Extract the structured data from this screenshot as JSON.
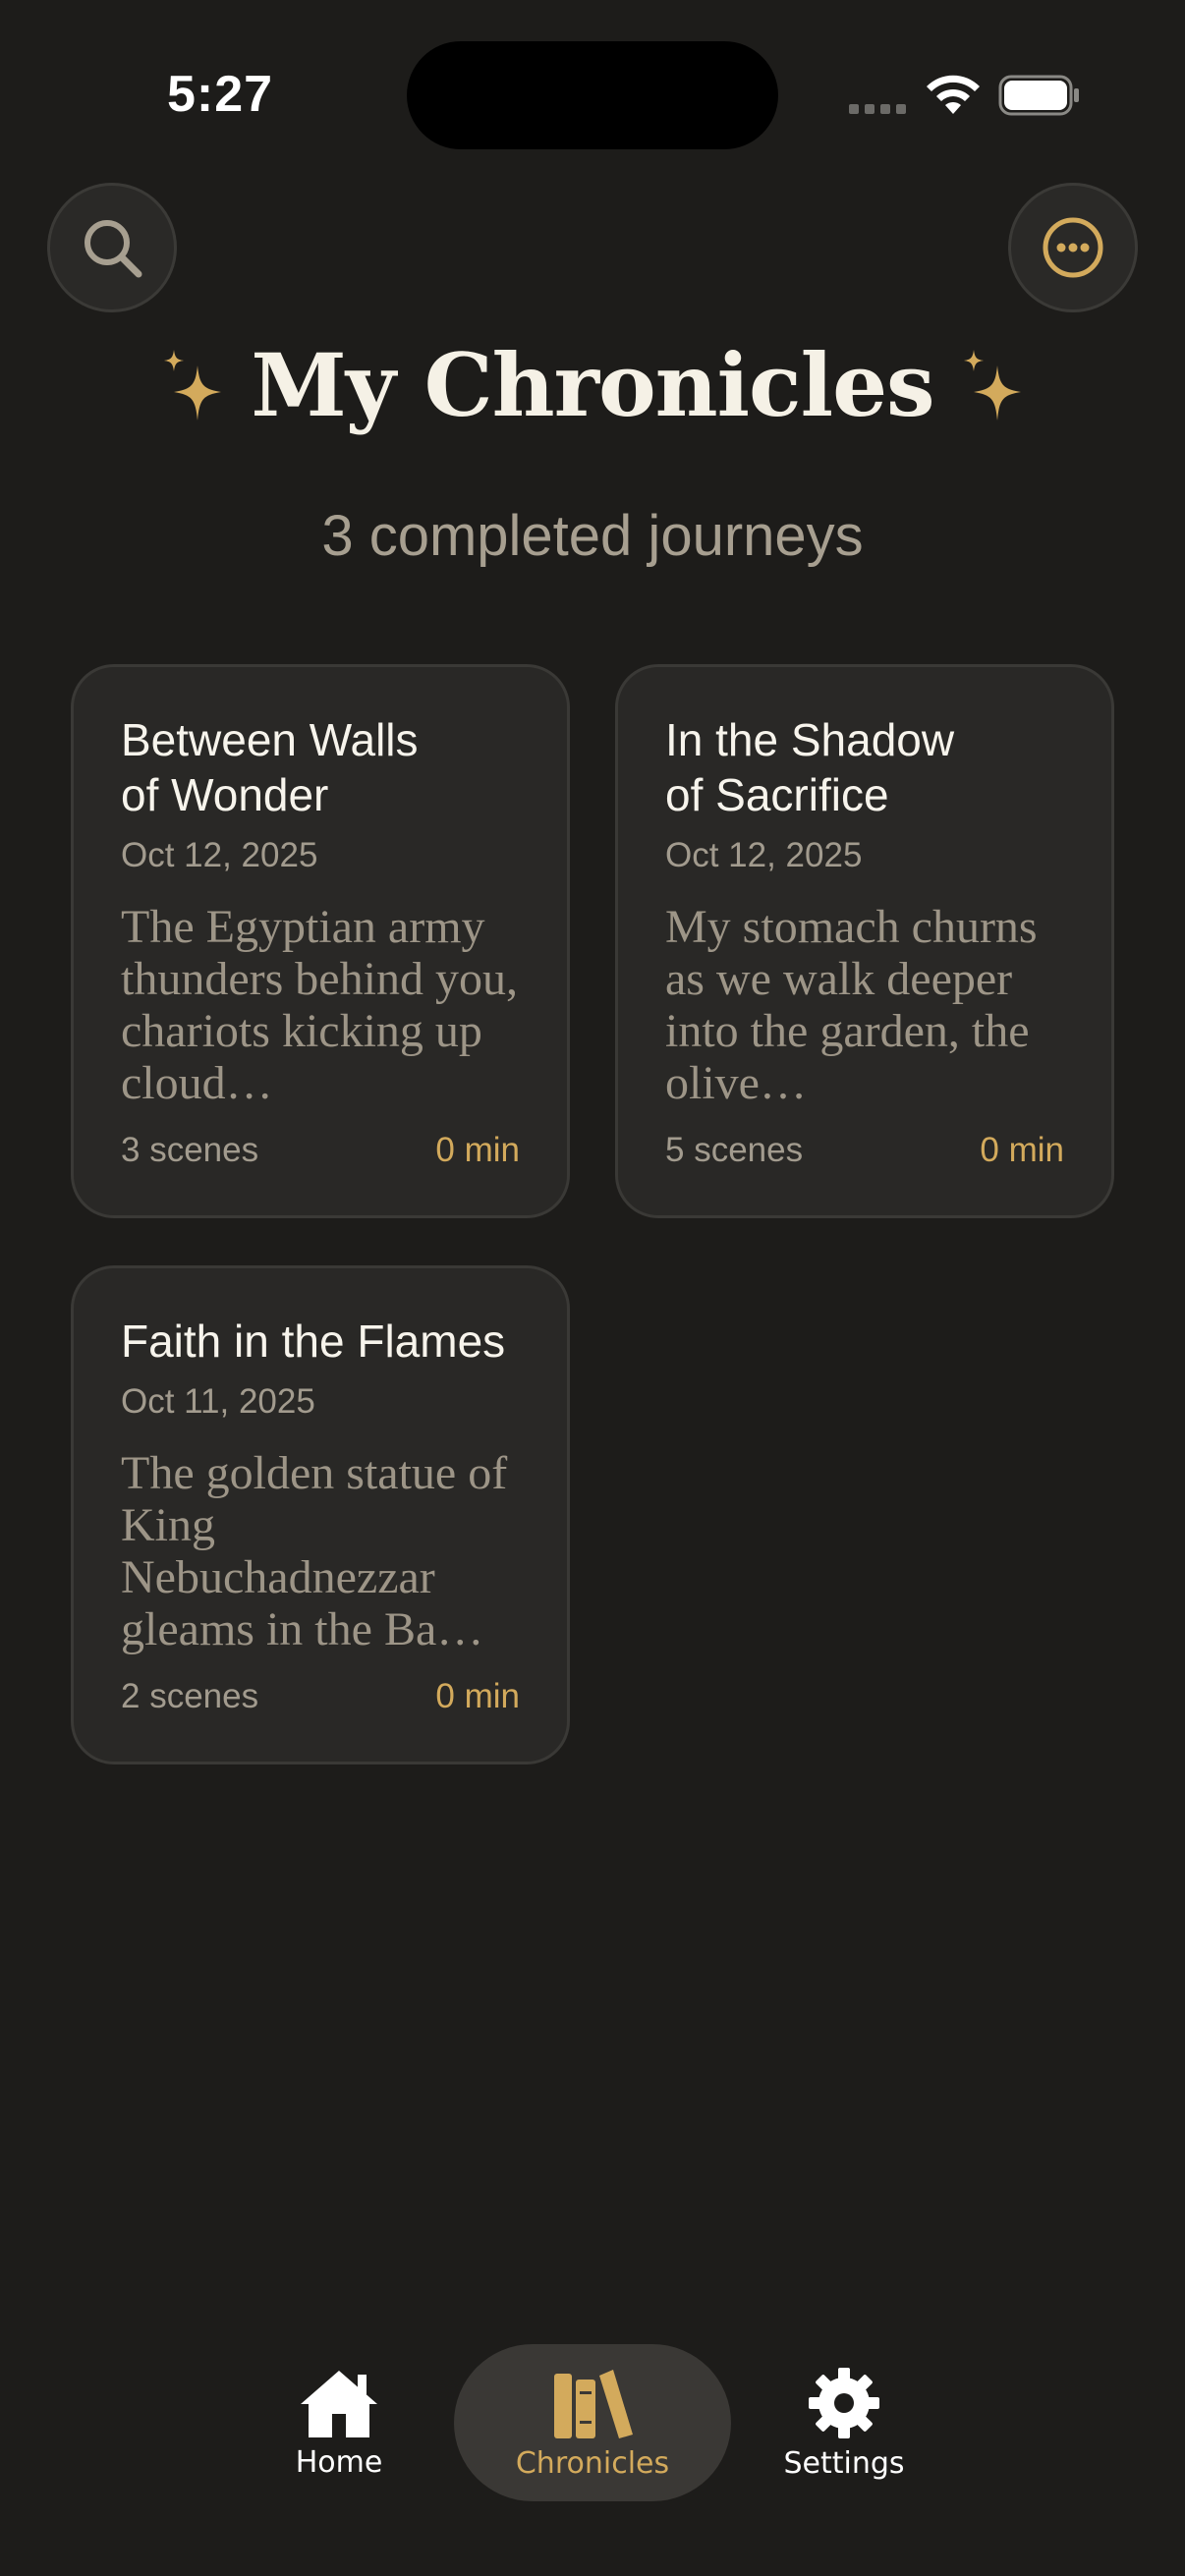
{
  "status_bar": {
    "time": "5:27"
  },
  "header": {
    "title": "My Chronicles",
    "subtitle": "3 completed journeys"
  },
  "cards": [
    {
      "title": "Between Walls of Wonder",
      "date": "Oct 12, 2025",
      "excerpt": "The Egyptian army thunders behind you, chariots kicking up cloud…",
      "scenes": "3 scenes",
      "duration": "0 min"
    },
    {
      "title": "In the Shadow of Sacrifice",
      "date": "Oct 12, 2025",
      "excerpt": "My stomach churns as we walk deeper into the garden, the olive…",
      "scenes": "5 scenes",
      "duration": "0 min"
    },
    {
      "title": "Faith in the Flames",
      "date": "Oct 11, 2025",
      "excerpt": "The golden statue of King Nebuchadnezzar gleams in the Ba…",
      "scenes": "2 scenes",
      "duration": "0 min"
    }
  ],
  "tab_bar": {
    "tabs": [
      {
        "label": "Home",
        "icon": "house-icon"
      },
      {
        "label": "Chronicles",
        "icon": "books-icon",
        "selected": true
      },
      {
        "label": "Settings",
        "icon": "gear-icon"
      }
    ]
  },
  "colors": {
    "background": "#1d1c1a",
    "card": "#292826",
    "accent_gold": "#d3aa5c",
    "muted_text": "#a29b8e"
  }
}
